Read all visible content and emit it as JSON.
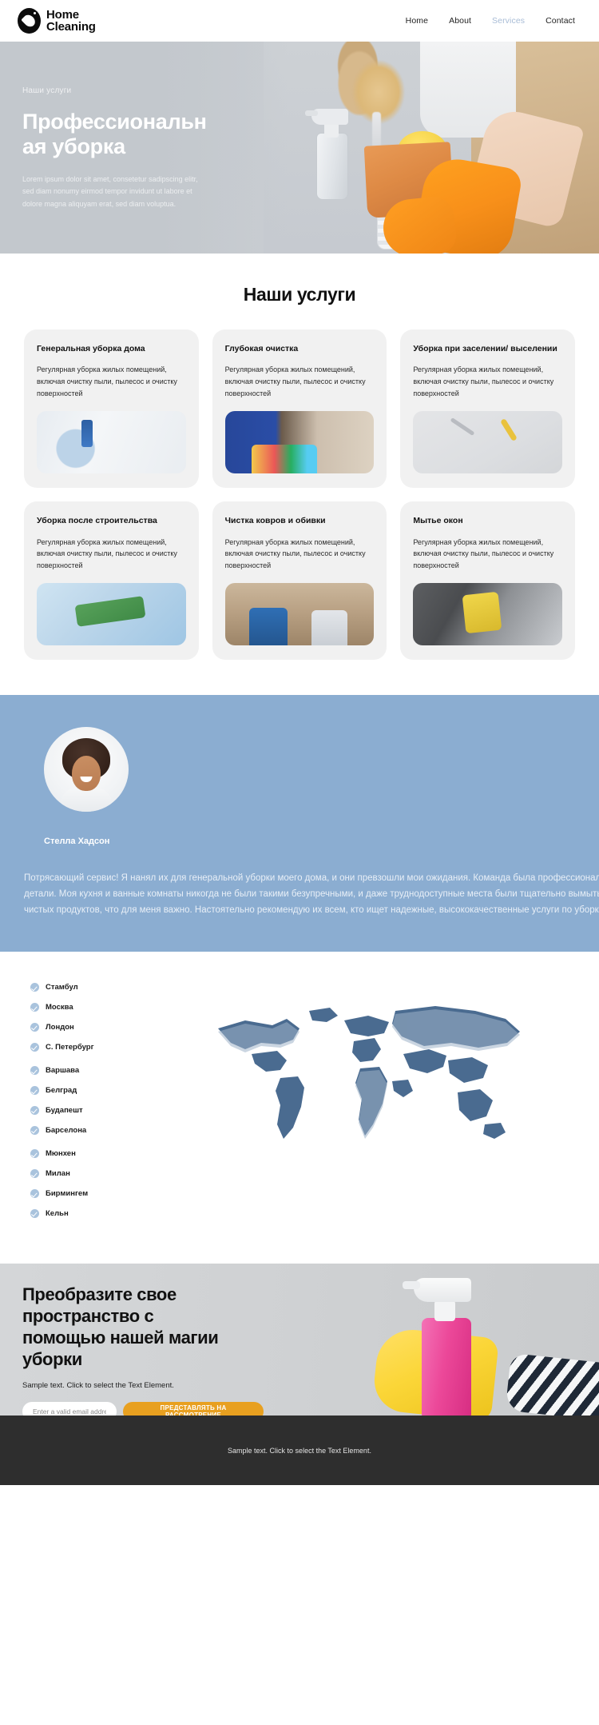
{
  "header": {
    "brand": {
      "line1": "Home",
      "line2": "Cleaning",
      "logo_icon": "water-drop-logo-icon"
    },
    "nav": [
      {
        "label": "Home",
        "active": false
      },
      {
        "label": "About",
        "active": false
      },
      {
        "label": "Services",
        "active": true
      },
      {
        "label": "Contact",
        "active": false
      }
    ]
  },
  "hero": {
    "eyebrow": "Наши услуги",
    "title_line1": "Профессиональн",
    "title_line2": "ая уборка",
    "description": "Lorem ipsum dolor sit amet, consetetur sadipscing elitr, sed diam nonumy eirmod tempor invidunt ut labore et dolore magna aliquyam erat, sed diam voluptua."
  },
  "services": {
    "title": "Наши услуги",
    "cards": [
      {
        "title": "Генеральная уборка дома",
        "desc": "Регулярная уборка жилых помещений, включая очистку пыли, пылесос и очистку поверхностей",
        "image": "spray-on-glass-photo"
      },
      {
        "title": "Глубокая очистка",
        "desc": "Регулярная уборка жилых помещений, включая очистку пыли, пылесос и очистку поверхностей",
        "image": "maid-with-supplies-photo"
      },
      {
        "title": "Уборка при заселении/ выселении",
        "desc": "Регулярная уборка жилых помещений, включая очистку пыли, пылесос и очистку поверхностей",
        "image": "cleaning-tools-flatlay-photo"
      },
      {
        "title": "Уборка после строительства",
        "desc": "Регулярная уборка жилых помещений, включая очистку пыли, пылесос и очистку поверхностей",
        "image": "gloved-hand-sponge-photo"
      },
      {
        "title": "Чистка ковров и обивки",
        "desc": "Регулярная уборка жилых помещений, включая очистку пыли, пылесос и очистку поверхностей",
        "image": "cleaning-couple-photo"
      },
      {
        "title": "Мытье окон",
        "desc": "Регулярная уборка жилых помещений, включая очистку пыли, пылесос и очистку поверхностей",
        "image": "window-washing-photo"
      }
    ]
  },
  "testimonial": {
    "avatar_icon": "customer-portrait-avatar",
    "name": "Стелла\nХадсон",
    "quote": "Потрясающий сервис! Я нанял их для генеральной уборки моего дома, и они превзошли мои ожидания. Команда была профессиональной, пунктуальной и уделяла внимание каждой детали. Моя кухня и ванные комнаты никогда не были такими безупречными, и даже труднодоступные места были тщательно вымыты. Я также ценю, что они используют экологически чистых продуктов, что для меня важно. Настоятельно рекомендую их всем, кто ищет надежные, высококачественные услуги по уборке!",
    "background_color": "#8badd1"
  },
  "locations": {
    "map_icon": "world-map-graphic",
    "groups": [
      {
        "cities": [
          "Стамбул",
          "Москва",
          "Лондон",
          "С. Петербург"
        ]
      },
      {
        "cities": [
          "Варшава",
          "Белград",
          "Будапешт",
          "Барселона"
        ]
      },
      {
        "cities": [
          "Мюнхен",
          "Милан",
          "Бирмингем",
          "Кельн"
        ]
      }
    ]
  },
  "cta": {
    "title": "Преобразите свое\nпространство с\nпомощью нашей магии\nуборки",
    "subtitle": "Sample text. Click to select the Text Element.",
    "email_placeholder": "Enter a valid email address",
    "button_label": "ПРЕДСТАВЛЯТЬ НА РАССМОТРЕНИЕ",
    "button_color": "#e8a020"
  },
  "footer": {
    "text": "Sample text. Click to select the Text Element."
  }
}
